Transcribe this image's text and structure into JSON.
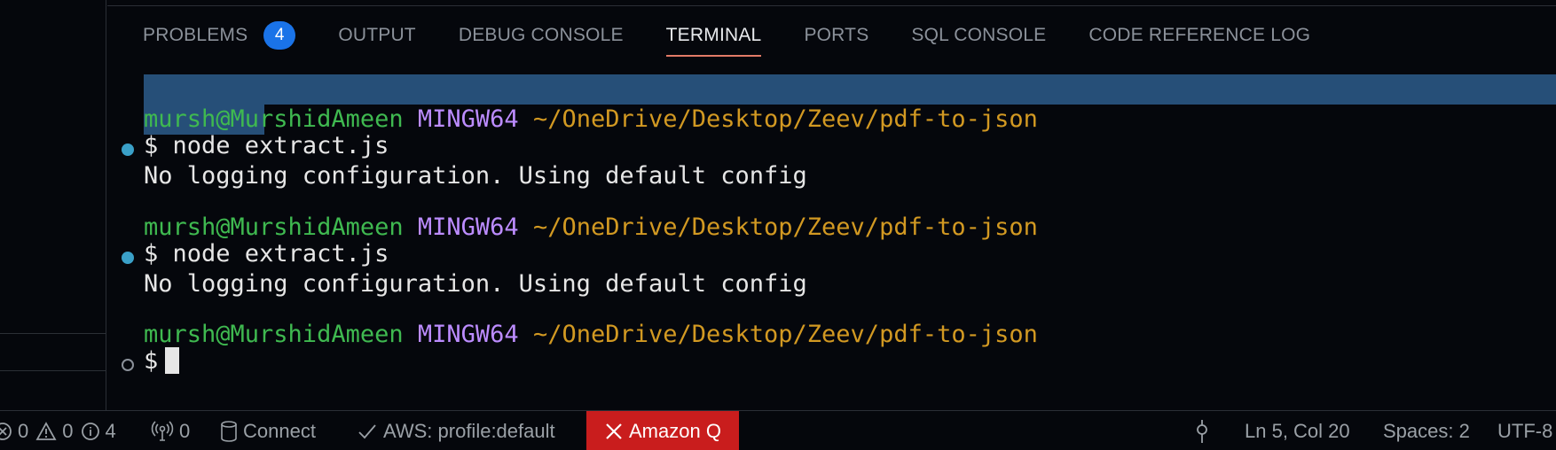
{
  "panel": {
    "tabs": [
      {
        "label": "PROBLEMS",
        "badge": "4"
      },
      {
        "label": "OUTPUT"
      },
      {
        "label": "DEBUG CONSOLE"
      },
      {
        "label": "TERMINAL",
        "active": true
      },
      {
        "label": "PORTS"
      },
      {
        "label": "SQL CONSOLE"
      },
      {
        "label": "CODE REFERENCE LOG"
      }
    ]
  },
  "terminal": {
    "user_host": "mursh@MurshidAmeen",
    "env": "MINGW64",
    "path": "~/OneDrive/Desktop/Zeev/pdf-to-json",
    "prompt": "$",
    "command": "node extract.js",
    "output": "No logging configuration. Using default config"
  },
  "status": {
    "errors": "0",
    "warnings": "0",
    "infos": "4",
    "ports": "0",
    "connect": "Connect",
    "aws": "AWS: profile:default",
    "amazonq": "Amazon Q",
    "position": "Ln 5, Col 20",
    "spaces": "Spaces: 2",
    "encoding": "UTF-8"
  },
  "colors": {
    "background": "#05070c",
    "user_host": "#3fb950",
    "env": "#bc8cff",
    "path": "#d29922",
    "badge": "#1a73e8",
    "amazonq_bg": "#c91d1d",
    "selection": "#264f78",
    "active_tab_underline": "#e27a66"
  }
}
